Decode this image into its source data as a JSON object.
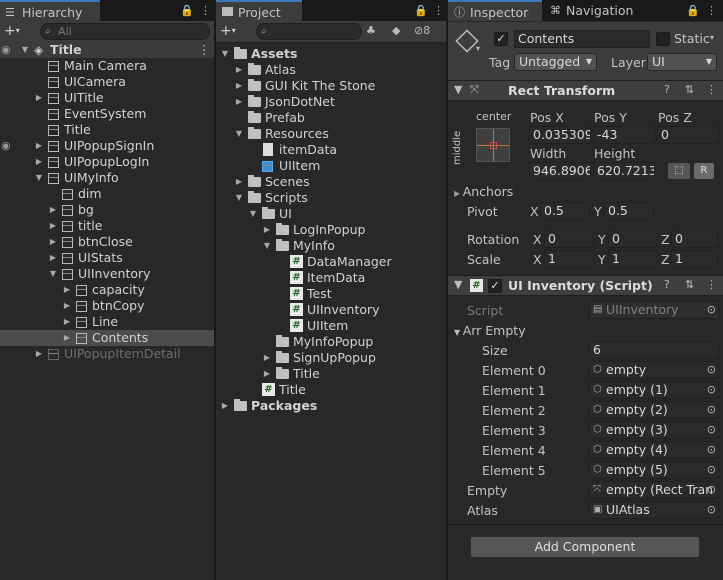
{
  "hierarchy": {
    "tab_label": "Hierarchy",
    "search_placeholder": "All",
    "rows": [
      {
        "label": "Title",
        "depth": 0,
        "arrow": "down",
        "icon": "scene",
        "eye": true,
        "menu": true
      },
      {
        "label": "Main Camera",
        "depth": 1,
        "arrow": "",
        "icon": "cube"
      },
      {
        "label": "UICamera",
        "depth": 1,
        "arrow": "",
        "icon": "cube"
      },
      {
        "label": "UITitle",
        "depth": 1,
        "arrow": "right",
        "icon": "cube"
      },
      {
        "label": "EventSystem",
        "depth": 1,
        "arrow": "",
        "icon": "cube"
      },
      {
        "label": "Title",
        "depth": 1,
        "arrow": "",
        "icon": "cube"
      },
      {
        "label": "UIPopupSignIn",
        "depth": 1,
        "arrow": "right",
        "icon": "cube",
        "eye": true
      },
      {
        "label": "UIPopupLogIn",
        "depth": 1,
        "arrow": "right",
        "icon": "cube"
      },
      {
        "label": "UIMyInfo",
        "depth": 1,
        "arrow": "down",
        "icon": "cube"
      },
      {
        "label": "dim",
        "depth": 2,
        "arrow": "",
        "icon": "cube"
      },
      {
        "label": "bg",
        "depth": 2,
        "arrow": "right",
        "icon": "cube"
      },
      {
        "label": "title",
        "depth": 2,
        "arrow": "right",
        "icon": "cube"
      },
      {
        "label": "btnClose",
        "depth": 2,
        "arrow": "right",
        "icon": "cube"
      },
      {
        "label": "UIStats",
        "depth": 2,
        "arrow": "right",
        "icon": "cube"
      },
      {
        "label": "UIInventory",
        "depth": 2,
        "arrow": "down",
        "icon": "cube"
      },
      {
        "label": "capacity",
        "depth": 3,
        "arrow": "right",
        "icon": "cube"
      },
      {
        "label": "btnCopy",
        "depth": 3,
        "arrow": "right",
        "icon": "cube"
      },
      {
        "label": "Line",
        "depth": 3,
        "arrow": "right",
        "icon": "cube"
      },
      {
        "label": "Contents",
        "depth": 3,
        "arrow": "right",
        "icon": "cube",
        "selected": true
      },
      {
        "label": "UIPopupItemDetail",
        "depth": 1,
        "arrow": "right",
        "icon": "cube",
        "dim": true
      }
    ]
  },
  "project": {
    "tab_label": "Project",
    "hidden_count": "8",
    "rows": [
      {
        "label": "Assets",
        "depth": 0,
        "arrow": "down",
        "icon": "folder",
        "bold": true
      },
      {
        "label": "Atlas",
        "depth": 1,
        "arrow": "right",
        "icon": "folder"
      },
      {
        "label": "GUI Kit The Stone",
        "depth": 1,
        "arrow": "right",
        "icon": "folder"
      },
      {
        "label": "JsonDotNet",
        "depth": 1,
        "arrow": "right",
        "icon": "folder"
      },
      {
        "label": "Prefab",
        "depth": 1,
        "arrow": "",
        "icon": "folder"
      },
      {
        "label": "Resources",
        "depth": 1,
        "arrow": "down",
        "icon": "folder"
      },
      {
        "label": "itemData",
        "depth": 2,
        "arrow": "",
        "icon": "doc"
      },
      {
        "label": "UIItem",
        "depth": 2,
        "arrow": "",
        "icon": "prefab"
      },
      {
        "label": "Scenes",
        "depth": 1,
        "arrow": "right",
        "icon": "folder"
      },
      {
        "label": "Scripts",
        "depth": 1,
        "arrow": "down",
        "icon": "folder"
      },
      {
        "label": "UI",
        "depth": 2,
        "arrow": "down",
        "icon": "folder"
      },
      {
        "label": "LogInPopup",
        "depth": 3,
        "arrow": "right",
        "icon": "folder"
      },
      {
        "label": "MyInfo",
        "depth": 3,
        "arrow": "down",
        "icon": "folder"
      },
      {
        "label": "DataManager",
        "depth": 4,
        "arrow": "",
        "icon": "script"
      },
      {
        "label": "ItemData",
        "depth": 4,
        "arrow": "",
        "icon": "script"
      },
      {
        "label": "Test",
        "depth": 4,
        "arrow": "",
        "icon": "script"
      },
      {
        "label": "UIInventory",
        "depth": 4,
        "arrow": "",
        "icon": "script"
      },
      {
        "label": "UIItem",
        "depth": 4,
        "arrow": "",
        "icon": "script"
      },
      {
        "label": "MyInfoPopup",
        "depth": 3,
        "arrow": "",
        "icon": "folder"
      },
      {
        "label": "SignUpPopup",
        "depth": 3,
        "arrow": "right",
        "icon": "folder"
      },
      {
        "label": "Title",
        "depth": 3,
        "arrow": "right",
        "icon": "folder"
      },
      {
        "label": "Title",
        "depth": 2,
        "arrow": "",
        "icon": "script"
      },
      {
        "label": "Packages",
        "depth": 0,
        "arrow": "right",
        "icon": "folder",
        "bold": true
      }
    ]
  },
  "inspector": {
    "tab_inspector": "Inspector",
    "tab_navigation": "Navigation",
    "object_name": "Contents",
    "static_label": "Static",
    "tag_label": "Tag",
    "tag_value": "Untagged",
    "layer_label": "Layer",
    "layer_value": "UI",
    "rect_transform": {
      "title": "Rect Transform",
      "anchor_h": "center",
      "anchor_v": "middle",
      "pos_x_label": "Pos X",
      "pos_x": "0.035309",
      "pos_y_label": "Pos Y",
      "pos_y": "-43",
      "pos_z_label": "Pos Z",
      "pos_z": "0",
      "width_label": "Width",
      "width": "946.8906",
      "height_label": "Height",
      "height": "620.7213",
      "r_button": "R",
      "anchors_label": "Anchors",
      "pivot_label": "Pivot",
      "pivot_x": "0.5",
      "pivot_y": "0.5",
      "rotation_label": "Rotation",
      "rot_x": "0",
      "rot_y": "0",
      "rot_z": "0",
      "scale_label": "Scale",
      "scale_x": "1",
      "scale_y": "1",
      "scale_z": "1",
      "x": "X",
      "y": "Y",
      "z": "Z"
    },
    "script_comp": {
      "title": "UI Inventory (Script)",
      "script_label": "Script",
      "script_value": "UIInventory",
      "arr_label": "Arr Empty",
      "size_label": "Size",
      "size_value": "6",
      "elements": [
        {
          "label": "Element 0",
          "value": "empty"
        },
        {
          "label": "Element 1",
          "value": "empty (1)"
        },
        {
          "label": "Element 2",
          "value": "empty (2)"
        },
        {
          "label": "Element 3",
          "value": "empty (3)"
        },
        {
          "label": "Element 4",
          "value": "empty (4)"
        },
        {
          "label": "Element 5",
          "value": "empty (5)"
        }
      ],
      "empty_label": "Empty",
      "empty_value": "empty (Rect Tran",
      "atlas_label": "Atlas",
      "atlas_value": "UIAtlas"
    },
    "add_component": "Add Component"
  }
}
